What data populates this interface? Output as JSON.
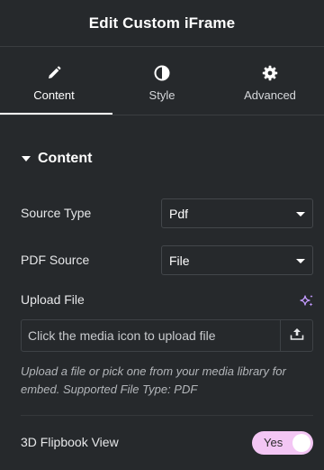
{
  "panel": {
    "title": "Edit Custom iFrame"
  },
  "tabs": [
    {
      "label": "Content",
      "icon": "pencil-icon",
      "active": true
    },
    {
      "label": "Style",
      "icon": "contrast-icon",
      "active": false
    },
    {
      "label": "Advanced",
      "icon": "gear-icon",
      "active": false
    }
  ],
  "section": {
    "title": "Content"
  },
  "fields": {
    "source_type": {
      "label": "Source Type",
      "value": "Pdf"
    },
    "pdf_source": {
      "label": "PDF Source",
      "value": "File"
    },
    "upload_file": {
      "label": "Upload File",
      "placeholder": "Click the media icon to upload file",
      "help": "Upload a file or pick one from your media library for embed. Supported File Type: PDF"
    },
    "flipbook": {
      "label": "3D Flipbook View",
      "toggle_text": "Yes",
      "enabled": true
    }
  },
  "colors": {
    "background": "#26292c",
    "accent": "#f3c6f4",
    "ai_icon": "#c39bff"
  }
}
